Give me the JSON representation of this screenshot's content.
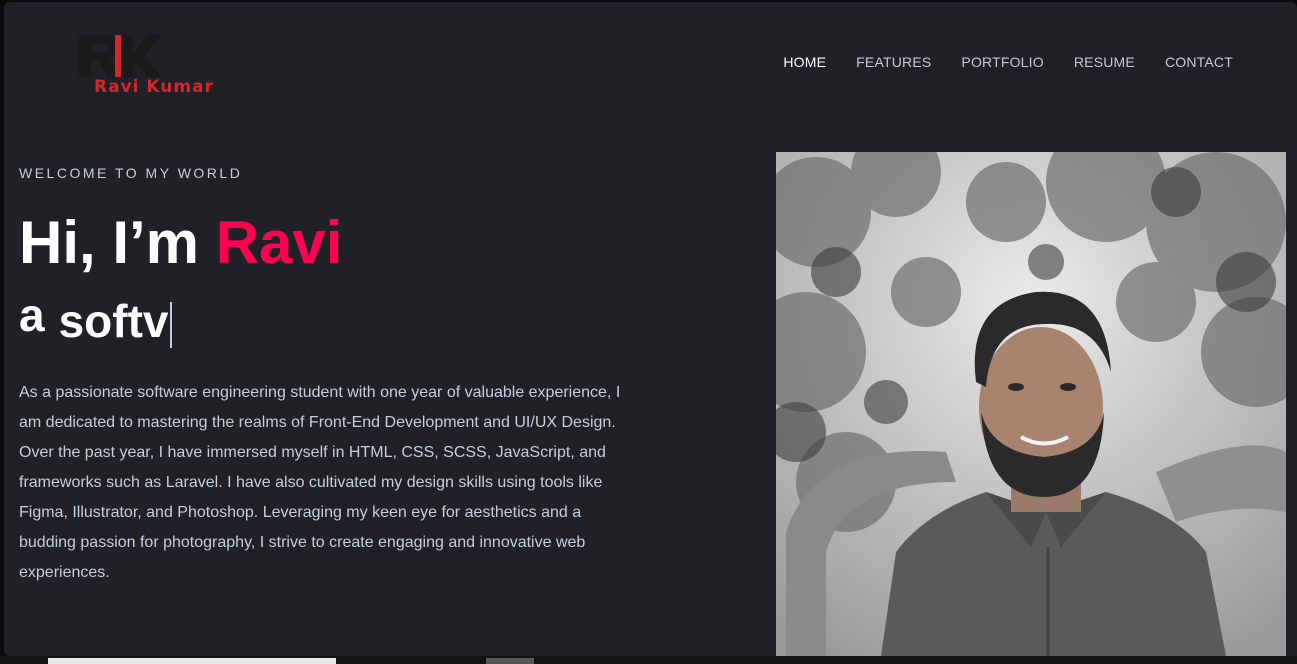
{
  "brand": {
    "monogram": "RK",
    "name": "Ravi Kumar",
    "colors": {
      "dark": "#1a1a1a",
      "red": "#d6262c"
    }
  },
  "nav": {
    "items": [
      {
        "label": "HOME",
        "active": true
      },
      {
        "label": "FEATURES",
        "active": false
      },
      {
        "label": "PORTFOLIO",
        "active": false
      },
      {
        "label": "RESUME",
        "active": false
      },
      {
        "label": "CONTACT",
        "active": false
      }
    ]
  },
  "hero": {
    "welcome": "WELCOME TO MY WORLD",
    "greeting": "Hi, I’m ",
    "name": "Ravi",
    "typing_prefix": "a",
    "typing_text": "softv",
    "bio": "As a passionate software engineering student with one year of valuable experience, I am dedicated to mastering the realms of Front-End Development and UI/UX Design. Over the past year, I have immersed myself in HTML, CSS, SCSS, JavaScript, and frameworks such as Laravel. I have also cultivated my design skills using tools like Figma, Illustrator, and Photoshop. Leveraging my keen eye for aesthetics and a budding passion for photography, I strive to create engaging and innovative web experiences."
  },
  "theme": {
    "background": "#1f2126",
    "accent": "#ff014f",
    "body_text": "#c4cfde"
  }
}
